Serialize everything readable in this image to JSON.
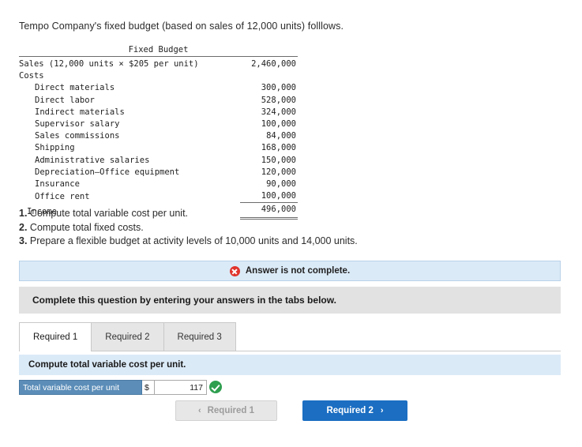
{
  "intro": "Tempo Company's fixed budget (based on sales of 12,000 units) folllows.",
  "budget": {
    "title": "Fixed Budget",
    "rows": [
      {
        "label": "Sales (12,000 units × $205 per unit)",
        "amount": "2,460,000",
        "indent": 0,
        "style": "topline"
      },
      {
        "label": "Costs",
        "amount": "",
        "indent": 0,
        "style": ""
      },
      {
        "label": "Direct materials",
        "amount": "300,000",
        "indent": 1,
        "style": ""
      },
      {
        "label": "Direct labor",
        "amount": "528,000",
        "indent": 1,
        "style": ""
      },
      {
        "label": "Indirect materials",
        "amount": "324,000",
        "indent": 1,
        "style": ""
      },
      {
        "label": "Supervisor salary",
        "amount": "100,000",
        "indent": 1,
        "style": ""
      },
      {
        "label": "Sales commissions",
        "amount": "84,000",
        "indent": 1,
        "style": ""
      },
      {
        "label": "Shipping",
        "amount": "168,000",
        "indent": 1,
        "style": ""
      },
      {
        "label": "Administrative salaries",
        "amount": "150,000",
        "indent": 1,
        "style": ""
      },
      {
        "label": "Depreciation—Office equipment",
        "amount": "120,000",
        "indent": 1,
        "style": ""
      },
      {
        "label": "Insurance",
        "amount": "90,000",
        "indent": 1,
        "style": ""
      },
      {
        "label": "Office rent",
        "amount": "100,000",
        "indent": 1,
        "style": ""
      },
      {
        "label": "Income",
        "amount": "496,000",
        "indent": 0,
        "style": "income last"
      }
    ]
  },
  "requirements": [
    {
      "num": "1.",
      "text": "Compute total variable cost per unit."
    },
    {
      "num": "2.",
      "text": "Compute total fixed costs."
    },
    {
      "num": "3.",
      "text": "Prepare a flexible budget at activity levels of 10,000 units and 14,000 units."
    }
  ],
  "answer_banner": "Answer is not complete.",
  "complete_bar": "Complete this question by entering your answers in the tabs below.",
  "tabs": [
    {
      "label": "Required 1",
      "active": true
    },
    {
      "label": "Required 2",
      "active": false
    },
    {
      "label": "Required 3",
      "active": false
    }
  ],
  "question_strip": "Compute total variable cost per unit.",
  "answer_row": {
    "label": "Total variable cost per unit",
    "currency": "$",
    "value": "117"
  },
  "nav": {
    "prev_label": "Required 1",
    "prev_chevron": "‹",
    "next_label": "Required 2",
    "next_chevron": "›"
  },
  "colors": {
    "banner_blue": "#dbeaf7",
    "gray_bar": "#e2e2e2",
    "label_blue": "#5b8db8",
    "primary_blue": "#1b6ec2",
    "error_red": "#e0342b",
    "check_green": "#2e9e4f"
  }
}
